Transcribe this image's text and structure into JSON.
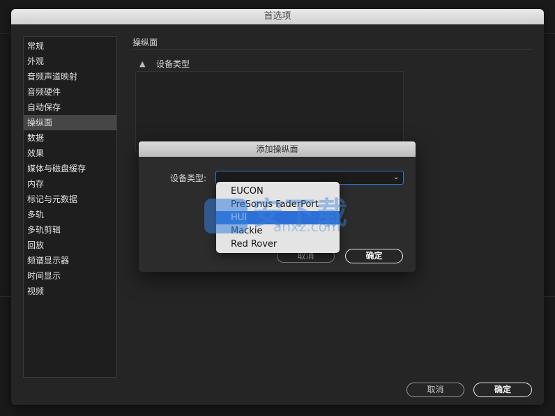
{
  "window": {
    "title": "首选项"
  },
  "sidebar": {
    "items": [
      {
        "label": "常规"
      },
      {
        "label": "外观"
      },
      {
        "label": "音频声道映射"
      },
      {
        "label": "音频硬件"
      },
      {
        "label": "自动保存"
      },
      {
        "label": "操纵面",
        "selected": true
      },
      {
        "label": "数据"
      },
      {
        "label": "效果"
      },
      {
        "label": "媒体与磁盘缓存"
      },
      {
        "label": "内存"
      },
      {
        "label": "标记与元数据"
      },
      {
        "label": "多轨"
      },
      {
        "label": "多轨剪辑"
      },
      {
        "label": "回放"
      },
      {
        "label": "频谱显示器"
      },
      {
        "label": "时间显示"
      },
      {
        "label": "视频"
      }
    ]
  },
  "panel": {
    "title": "操纵面",
    "list_header": {
      "sort_icon": "up-arrow-icon",
      "column": "设备类型"
    }
  },
  "footer": {
    "cancel_label": "取消",
    "ok_label": "确定"
  },
  "dialog": {
    "title": "添加操纵面",
    "device_type_label": "设备类型:",
    "device_type_value": "",
    "cancel_label": "取消",
    "ok_label": "确定"
  },
  "dropdown": {
    "options": [
      {
        "label": "EUCON"
      },
      {
        "label": "PreSonus FaderPort"
      },
      {
        "label": "HUI",
        "highlighted": true
      },
      {
        "label": "Mackie"
      },
      {
        "label": "Red Rover"
      }
    ]
  },
  "watermark": {
    "text": "安下载",
    "sub": "anxz.com"
  },
  "colors": {
    "accent": "#2c6fd6",
    "window_bg": "#252525",
    "selected_item": "#464646"
  }
}
